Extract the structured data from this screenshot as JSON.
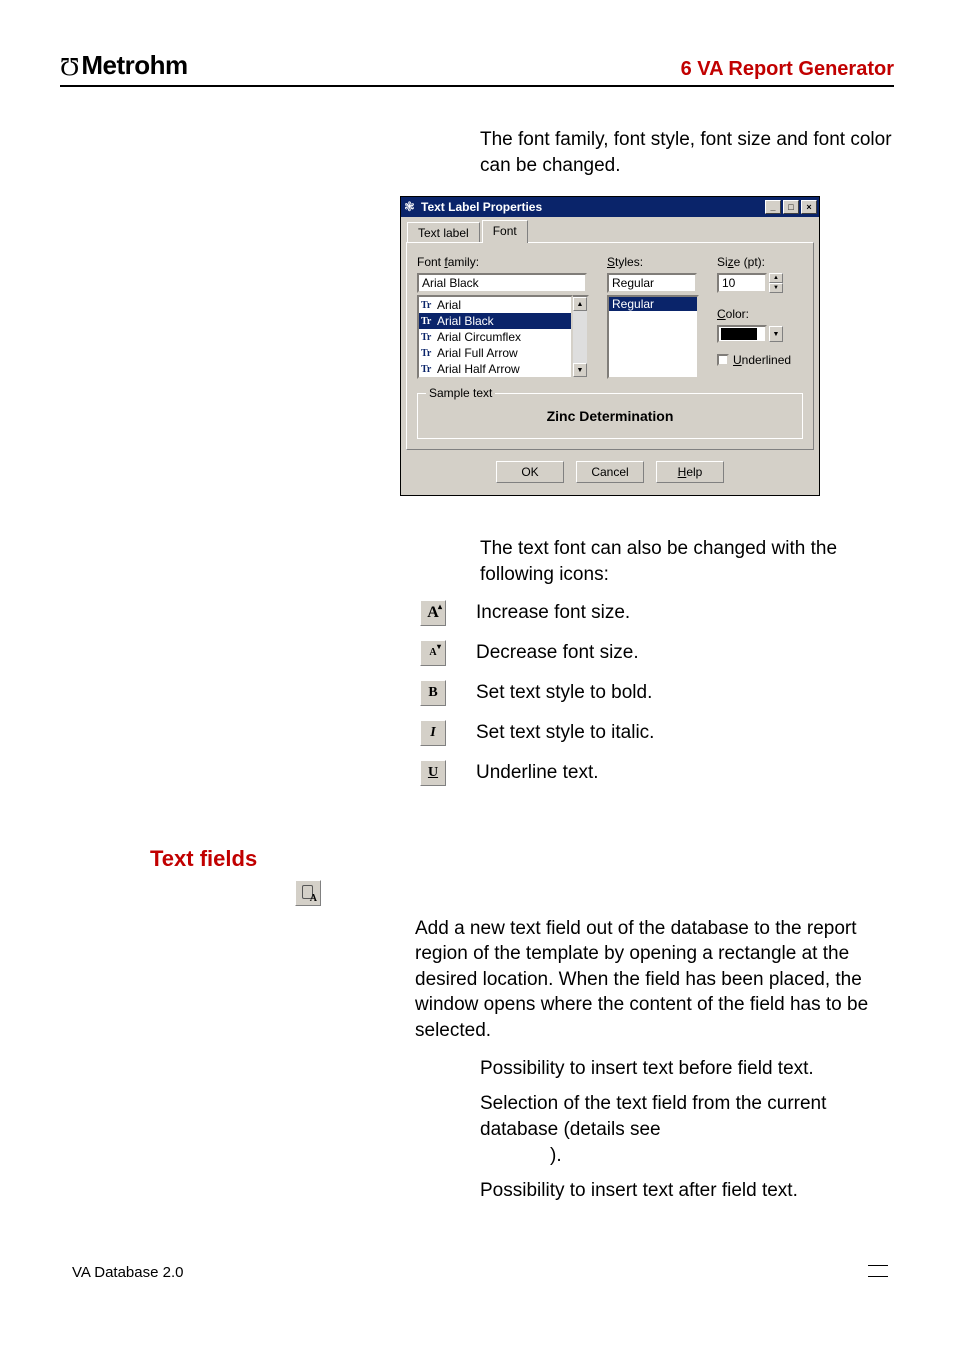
{
  "header": {
    "logo": "Metrohm",
    "title": "6  VA Report Generator"
  },
  "intro1": "The font family, font style, font size and font color can be changed.",
  "dialog": {
    "title": "Text Label Properties",
    "tabs": {
      "text_label": "Text label",
      "font": "Font"
    },
    "labels": {
      "family": "Font family:",
      "styles": "Styles:",
      "size": "Size (pt):",
      "color": "Color:",
      "underlined": "Underlined",
      "sample_group": "Sample text"
    },
    "values": {
      "family": "Arial Black",
      "style": "Regular",
      "size": "10"
    },
    "font_list": [
      "Arial",
      "Arial Black",
      "Arial Circumflex",
      "Arial Full Arrow",
      "Arial Half Arrow"
    ],
    "styles_list": [
      "Regular"
    ],
    "sample_text": "Zinc Determination",
    "buttons": {
      "ok": "OK",
      "cancel": "Cancel",
      "help": "Help"
    }
  },
  "intro2": "The text font can also be changed with the following icons:",
  "icons": {
    "increase": "Increase font size.",
    "decrease": "Decrease font size.",
    "bold": "Set text style to bold.",
    "italic": "Set text style to italic.",
    "underline": "Underline text."
  },
  "section": "Text fields",
  "para1": "Add a new text field out of the database to the report region of the template by opening a rectangle at the desired location. When the field has been placed, the                          window opens where the content of the field has to be selected.",
  "sub1": "Possibility to insert text before field text.",
  "sub2a": "Selection of the text field from the current database (details see ",
  "sub2b": ").",
  "sub3": "Possibility to insert text after field text.",
  "footer": {
    "left": "VA Database 2.0"
  }
}
